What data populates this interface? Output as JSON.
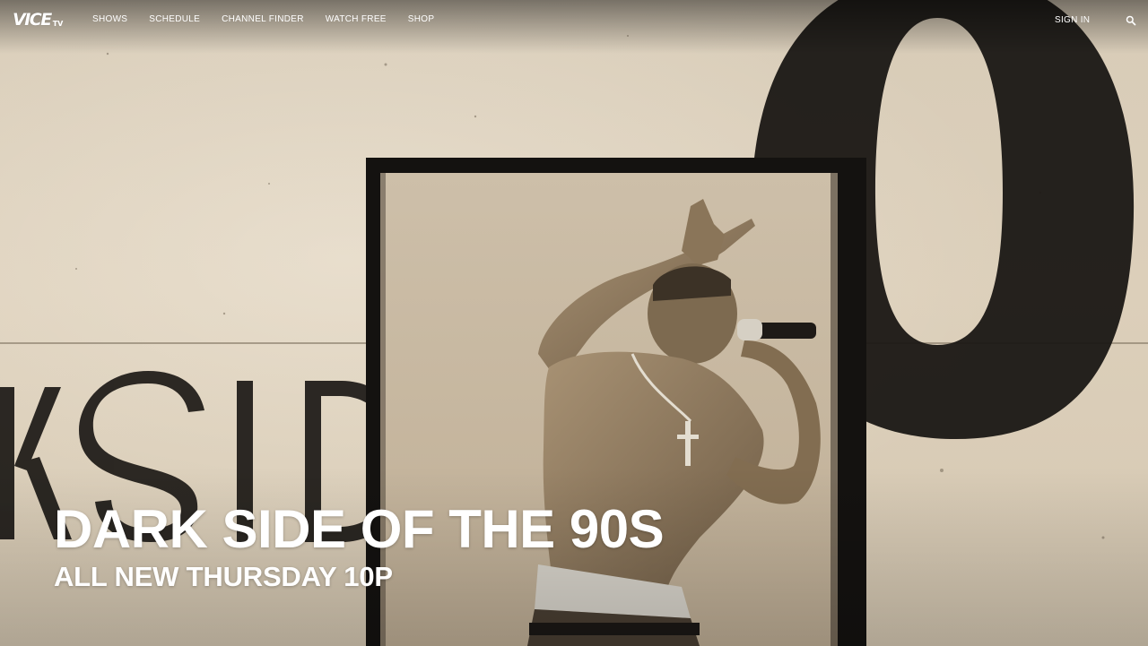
{
  "brand": {
    "logo_main": "VICE",
    "logo_sub": "TV"
  },
  "nav": {
    "items": [
      {
        "label": "SHOWS"
      },
      {
        "label": "SCHEDULE"
      },
      {
        "label": "CHANNEL FINDER"
      },
      {
        "label": "WATCH FREE"
      },
      {
        "label": "SHOP"
      }
    ],
    "sign_in": "SIGN IN",
    "search_icon": "search-icon"
  },
  "hero": {
    "title": "DARK SIDE OF THE 90S",
    "subtitle": "ALL NEW THURSDAY 10P",
    "background_word": "KSIDE",
    "background_numeral": "0"
  },
  "colors": {
    "text": "#ffffff",
    "paper": "#d9cdb9",
    "ink": "#1a1714"
  }
}
